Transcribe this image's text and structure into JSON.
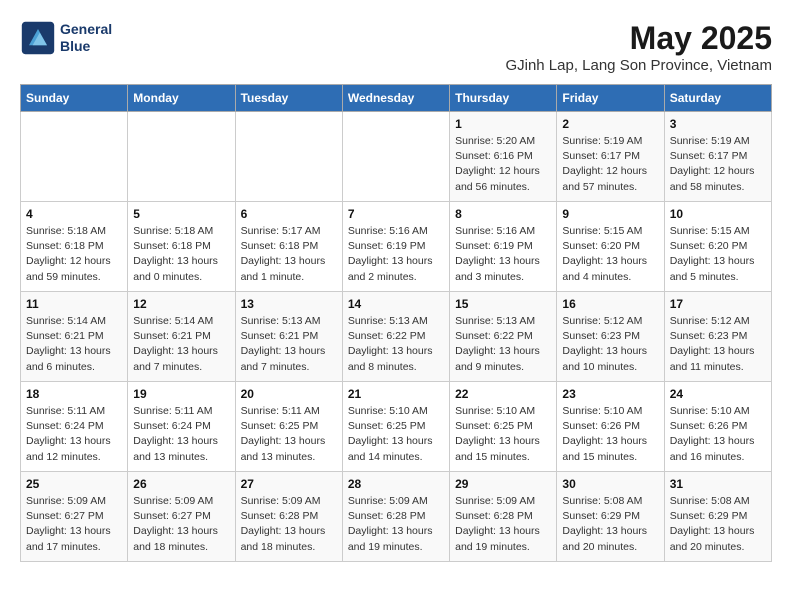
{
  "logo": {
    "line1": "General",
    "line2": "Blue"
  },
  "title": "May 2025",
  "subtitle": "GJinh Lap, Lang Son Province, Vietnam",
  "weekdays": [
    "Sunday",
    "Monday",
    "Tuesday",
    "Wednesday",
    "Thursday",
    "Friday",
    "Saturday"
  ],
  "weeks": [
    [
      {
        "day": "",
        "info": ""
      },
      {
        "day": "",
        "info": ""
      },
      {
        "day": "",
        "info": ""
      },
      {
        "day": "",
        "info": ""
      },
      {
        "day": "1",
        "info": "Sunrise: 5:20 AM\nSunset: 6:16 PM\nDaylight: 12 hours\nand 56 minutes."
      },
      {
        "day": "2",
        "info": "Sunrise: 5:19 AM\nSunset: 6:17 PM\nDaylight: 12 hours\nand 57 minutes."
      },
      {
        "day": "3",
        "info": "Sunrise: 5:19 AM\nSunset: 6:17 PM\nDaylight: 12 hours\nand 58 minutes."
      }
    ],
    [
      {
        "day": "4",
        "info": "Sunrise: 5:18 AM\nSunset: 6:18 PM\nDaylight: 12 hours\nand 59 minutes."
      },
      {
        "day": "5",
        "info": "Sunrise: 5:18 AM\nSunset: 6:18 PM\nDaylight: 13 hours\nand 0 minutes."
      },
      {
        "day": "6",
        "info": "Sunrise: 5:17 AM\nSunset: 6:18 PM\nDaylight: 13 hours\nand 1 minute."
      },
      {
        "day": "7",
        "info": "Sunrise: 5:16 AM\nSunset: 6:19 PM\nDaylight: 13 hours\nand 2 minutes."
      },
      {
        "day": "8",
        "info": "Sunrise: 5:16 AM\nSunset: 6:19 PM\nDaylight: 13 hours\nand 3 minutes."
      },
      {
        "day": "9",
        "info": "Sunrise: 5:15 AM\nSunset: 6:20 PM\nDaylight: 13 hours\nand 4 minutes."
      },
      {
        "day": "10",
        "info": "Sunrise: 5:15 AM\nSunset: 6:20 PM\nDaylight: 13 hours\nand 5 minutes."
      }
    ],
    [
      {
        "day": "11",
        "info": "Sunrise: 5:14 AM\nSunset: 6:21 PM\nDaylight: 13 hours\nand 6 minutes."
      },
      {
        "day": "12",
        "info": "Sunrise: 5:14 AM\nSunset: 6:21 PM\nDaylight: 13 hours\nand 7 minutes."
      },
      {
        "day": "13",
        "info": "Sunrise: 5:13 AM\nSunset: 6:21 PM\nDaylight: 13 hours\nand 7 minutes."
      },
      {
        "day": "14",
        "info": "Sunrise: 5:13 AM\nSunset: 6:22 PM\nDaylight: 13 hours\nand 8 minutes."
      },
      {
        "day": "15",
        "info": "Sunrise: 5:13 AM\nSunset: 6:22 PM\nDaylight: 13 hours\nand 9 minutes."
      },
      {
        "day": "16",
        "info": "Sunrise: 5:12 AM\nSunset: 6:23 PM\nDaylight: 13 hours\nand 10 minutes."
      },
      {
        "day": "17",
        "info": "Sunrise: 5:12 AM\nSunset: 6:23 PM\nDaylight: 13 hours\nand 11 minutes."
      }
    ],
    [
      {
        "day": "18",
        "info": "Sunrise: 5:11 AM\nSunset: 6:24 PM\nDaylight: 13 hours\nand 12 minutes."
      },
      {
        "day": "19",
        "info": "Sunrise: 5:11 AM\nSunset: 6:24 PM\nDaylight: 13 hours\nand 13 minutes."
      },
      {
        "day": "20",
        "info": "Sunrise: 5:11 AM\nSunset: 6:25 PM\nDaylight: 13 hours\nand 13 minutes."
      },
      {
        "day": "21",
        "info": "Sunrise: 5:10 AM\nSunset: 6:25 PM\nDaylight: 13 hours\nand 14 minutes."
      },
      {
        "day": "22",
        "info": "Sunrise: 5:10 AM\nSunset: 6:25 PM\nDaylight: 13 hours\nand 15 minutes."
      },
      {
        "day": "23",
        "info": "Sunrise: 5:10 AM\nSunset: 6:26 PM\nDaylight: 13 hours\nand 15 minutes."
      },
      {
        "day": "24",
        "info": "Sunrise: 5:10 AM\nSunset: 6:26 PM\nDaylight: 13 hours\nand 16 minutes."
      }
    ],
    [
      {
        "day": "25",
        "info": "Sunrise: 5:09 AM\nSunset: 6:27 PM\nDaylight: 13 hours\nand 17 minutes."
      },
      {
        "day": "26",
        "info": "Sunrise: 5:09 AM\nSunset: 6:27 PM\nDaylight: 13 hours\nand 18 minutes."
      },
      {
        "day": "27",
        "info": "Sunrise: 5:09 AM\nSunset: 6:28 PM\nDaylight: 13 hours\nand 18 minutes."
      },
      {
        "day": "28",
        "info": "Sunrise: 5:09 AM\nSunset: 6:28 PM\nDaylight: 13 hours\nand 19 minutes."
      },
      {
        "day": "29",
        "info": "Sunrise: 5:09 AM\nSunset: 6:28 PM\nDaylight: 13 hours\nand 19 minutes."
      },
      {
        "day": "30",
        "info": "Sunrise: 5:08 AM\nSunset: 6:29 PM\nDaylight: 13 hours\nand 20 minutes."
      },
      {
        "day": "31",
        "info": "Sunrise: 5:08 AM\nSunset: 6:29 PM\nDaylight: 13 hours\nand 20 minutes."
      }
    ]
  ]
}
